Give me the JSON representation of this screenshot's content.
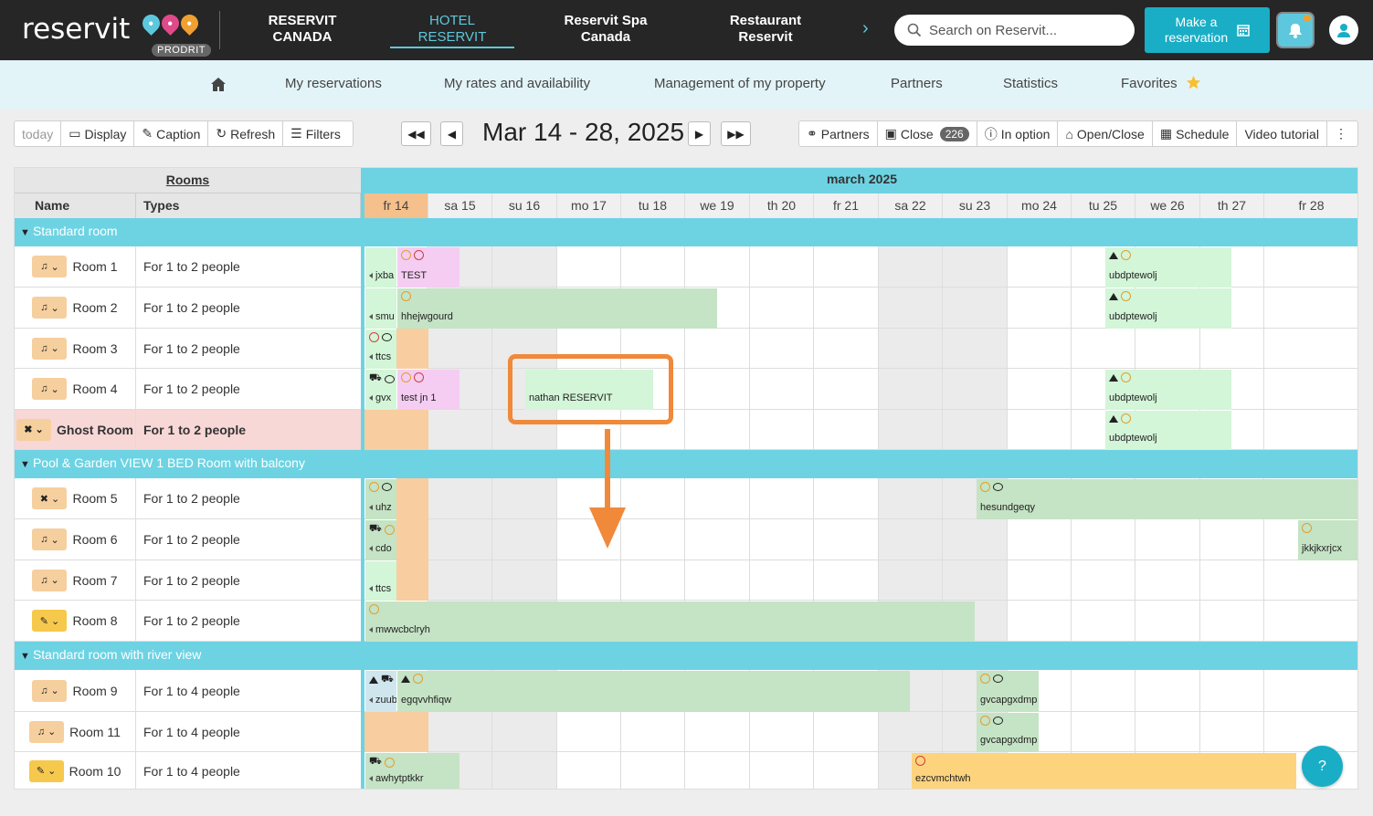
{
  "header": {
    "logo": "reservit",
    "prodrit": "PRODRIT",
    "nav": [
      {
        "line1": "RESERVIT",
        "line2": "CANADA"
      },
      {
        "line1": "HOTEL",
        "line2": "RESERVIT"
      },
      {
        "line1": "Reservit Spa",
        "line2": "Canada"
      },
      {
        "line1": "Restaurant",
        "line2": "Reservit"
      }
    ],
    "search_placeholder": "Search on Reservit...",
    "make_res_line1": "Make a",
    "make_res_line2": "reservation"
  },
  "subnav": [
    "My reservations",
    "My rates and availability",
    "Management of my property",
    "Partners",
    "Statistics",
    "Favorites"
  ],
  "toolbar_left": [
    "today",
    "Display",
    "Caption",
    "Refresh",
    "Filters"
  ],
  "date_range": "Mar 14 - 28, 2025",
  "toolbar_right": {
    "partners": "Partners",
    "close": "Close",
    "close_count": "226",
    "in_option": "In option",
    "open_close": "Open/Close",
    "schedule": "Schedule",
    "video": "Video tutorial"
  },
  "grid": {
    "rooms_header": "Rooms",
    "col_name": "Name",
    "col_types": "Types",
    "month": "march 2025",
    "days": [
      "fr 14",
      "sa 15",
      "su 16",
      "mo 17",
      "tu 18",
      "we 19",
      "th 20",
      "fr 21",
      "sa 22",
      "su 23",
      "mo 24",
      "tu 25",
      "we 26",
      "th 27",
      "fr 28"
    ],
    "groups": [
      "Standard room",
      "Pool & Garden VIEW 1 BED Room with balcony",
      "Standard room with river view"
    ],
    "rooms": [
      {
        "name": "Room 1",
        "type": "For 1 to 2 people"
      },
      {
        "name": "Room 2",
        "type": "For 1 to 2 people"
      },
      {
        "name": "Room 3",
        "type": "For 1 to 2 people"
      },
      {
        "name": "Room 4",
        "type": "For 1 to 2 people"
      },
      {
        "name": "Ghost Room",
        "type": "For 1 to 2 people"
      },
      {
        "name": "Room 5",
        "type": "For 1 to 2 people"
      },
      {
        "name": "Room 6",
        "type": "For 1 to 2 people"
      },
      {
        "name": "Room 7",
        "type": "For 1 to 2 people"
      },
      {
        "name": "Room 8",
        "type": "For 1 to 2 people"
      },
      {
        "name": "Room 9",
        "type": "For 1 to 4 people"
      },
      {
        "name": "Room 11",
        "type": "For 1 to 4 people"
      },
      {
        "name": "Room 10",
        "type": "For 1 to 4 people"
      }
    ],
    "bookings": {
      "r1a": "jxba",
      "r1b": "TEST",
      "r1c": "ubdptewolj",
      "r2a": "smu",
      "r2b": "hhejwgourd",
      "r2c": "ubdptewolj",
      "r3a": "ttcs",
      "r4a": "gvx",
      "r4b": "test jn 1",
      "r4c": "nathan RESERVIT",
      "r4d": "ubdptewolj",
      "g1": "ubdptewolj",
      "r5a": "uhz",
      "r5b": "hesundgeqy",
      "r6a": "cdo",
      "r6b": "jkkjkxrjcx",
      "r7a": "ttcs",
      "r8a": "mwwcbclryh",
      "r9a": "zuub",
      "r9b": "egqvvhfiqw",
      "r9c": "gvcapgxdmp",
      "r11a": "gvcapgxdmp",
      "r10a": "awhytptkkr",
      "r10b": "ezcvmchtwh"
    }
  },
  "colors": {
    "accent": "#19aec6",
    "header_bg": "#262626",
    "group_bg": "#6dd3e3",
    "booking_green": "#c5e3c5",
    "booking_light": "#d3f5d8",
    "booking_pink": "#f5ccf2",
    "booking_orange": "#fdd37e",
    "highlight": "#f0893a"
  },
  "help": "?"
}
